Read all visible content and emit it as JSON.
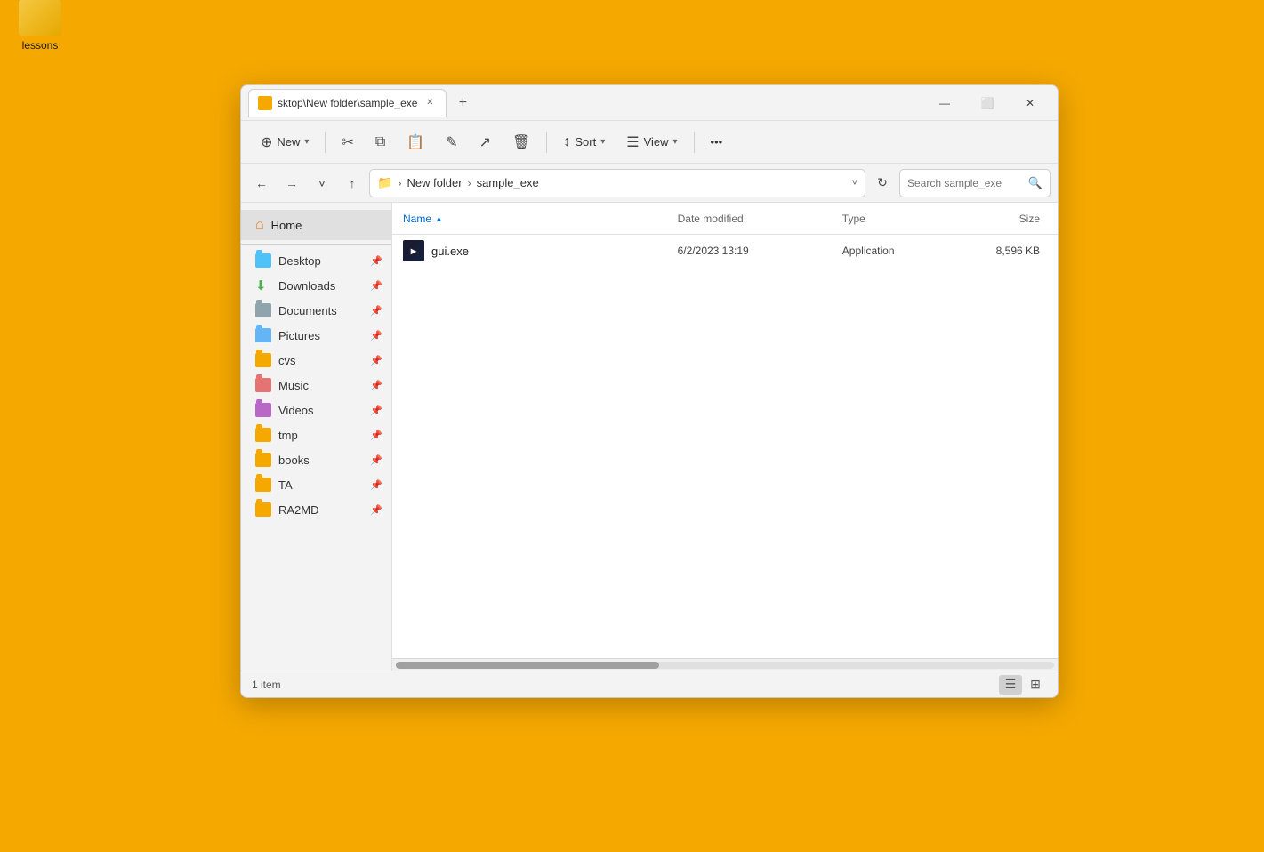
{
  "desktop": {
    "icon_label": "lessons"
  },
  "window": {
    "tab_title": "sktop\\New folder\\sample_exe",
    "tab_new_label": "+",
    "minimize": "—",
    "maximize": "⬜",
    "close": "✕"
  },
  "toolbar": {
    "new_label": "New",
    "cut_icon": "✂",
    "copy_icon": "⧉",
    "paste_icon": "📋",
    "rename_icon": "✎",
    "share_icon": "↗",
    "delete_icon": "🗑",
    "sort_label": "Sort",
    "view_label": "View",
    "more_icon": "•••"
  },
  "address_bar": {
    "folder_label": "New folder",
    "current_folder": "sample_exe",
    "separator": "›",
    "search_placeholder": "Search sample_exe"
  },
  "navigation": {
    "back": "←",
    "forward": "→",
    "recent": "˅",
    "up": "↑",
    "refresh": "↻"
  },
  "sidebar": {
    "home_label": "Home",
    "items": [
      {
        "id": "desktop",
        "label": "Desktop",
        "icon_type": "blue",
        "pinned": true
      },
      {
        "id": "downloads",
        "label": "Downloads",
        "icon_type": "download",
        "pinned": true
      },
      {
        "id": "documents",
        "label": "Documents",
        "icon_type": "doc",
        "pinned": true
      },
      {
        "id": "pictures",
        "label": "Pictures",
        "icon_type": "img",
        "pinned": true
      },
      {
        "id": "cvs",
        "label": "cvs",
        "icon_type": "default",
        "pinned": true
      },
      {
        "id": "music",
        "label": "Music",
        "icon_type": "music",
        "pinned": true
      },
      {
        "id": "videos",
        "label": "Videos",
        "icon_type": "video",
        "pinned": true
      },
      {
        "id": "tmp",
        "label": "tmp",
        "icon_type": "default",
        "pinned": true
      },
      {
        "id": "books",
        "label": "books",
        "icon_type": "default",
        "pinned": true
      },
      {
        "id": "ta",
        "label": "TA",
        "icon_type": "default",
        "pinned": true
      },
      {
        "id": "ra2md",
        "label": "RA2MD",
        "icon_type": "default",
        "pinned": true
      }
    ]
  },
  "file_list": {
    "columns": {
      "name": "Name",
      "date_modified": "Date modified",
      "type": "Type",
      "size": "Size"
    },
    "files": [
      {
        "name": "gui.exe",
        "date_modified": "6/2/2023 13:19",
        "type": "Application",
        "size": "8,596 KB"
      }
    ]
  },
  "status_bar": {
    "item_count": "1 item"
  }
}
